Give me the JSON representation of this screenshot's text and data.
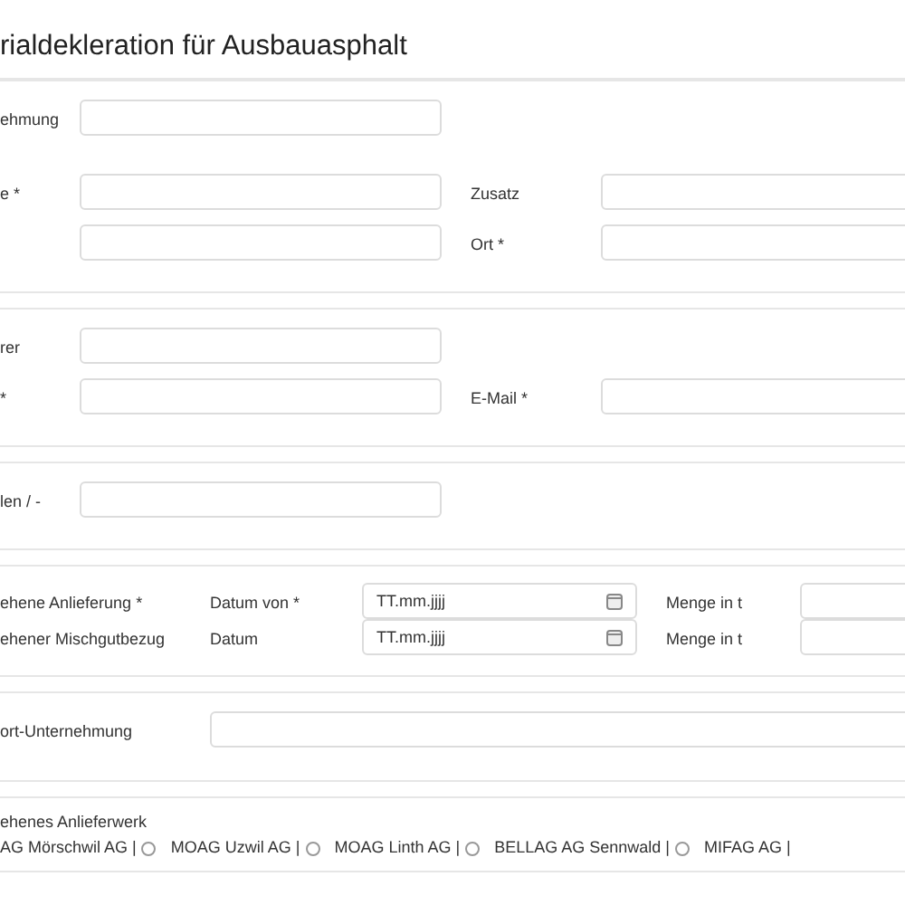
{
  "title": "rialdekleration für Ausbauasphalt",
  "sections": [
    {
      "kind": "form",
      "rows": [
        {
          "fields": [
            {
              "kind": "text",
              "label": "ehmung"
            }
          ]
        },
        {
          "fields": [
            {
              "kind": "text",
              "label": "e *"
            },
            {
              "kind": "text",
              "label": "Zusatz"
            }
          ]
        },
        {
          "fields": [
            {
              "kind": "text"
            },
            {
              "kind": "text",
              "label": "Ort *"
            }
          ]
        }
      ]
    },
    {
      "kind": "form",
      "rows": [
        {
          "fields": [
            {
              "kind": "text",
              "label": "rer"
            }
          ]
        },
        {
          "fields": [
            {
              "kind": "text",
              "label": "*"
            },
            {
              "kind": "text",
              "label": "E-Mail *"
            }
          ]
        }
      ]
    },
    {
      "kind": "form",
      "rows": [
        {
          "fields": [
            {
              "kind": "text",
              "label": "len / -"
            }
          ]
        }
      ]
    },
    {
      "kind": "schedule",
      "rows": [
        {
          "label": "ehene Anlieferung *",
          "fields": [
            {
              "kind": "date",
              "label": "Datum von *",
              "placeholder": "TT.mm.jjjj"
            },
            {
              "kind": "text",
              "label": "Menge in t"
            }
          ]
        },
        {
          "label": "ehener Mischgutbezug",
          "fields": [
            {
              "kind": "date",
              "label": "Datum",
              "placeholder": "TT.mm.jjjj"
            },
            {
              "kind": "text",
              "label": "Menge in t"
            }
          ]
        }
      ]
    },
    {
      "kind": "wide",
      "rows": [
        {
          "label": "ort-Unternehmung",
          "fields": [
            {
              "kind": "text"
            }
          ]
        }
      ]
    },
    {
      "kind": "choice",
      "label": "ehenes Anlieferwerk",
      "leading_text": "AG Mörschwil AG |",
      "options": [
        {
          "label": "MOAG Uzwil AG |",
          "selected": false
        },
        {
          "label": "MOAG Linth AG |",
          "selected": false
        },
        {
          "label": "BELLAG AG Sennwald |",
          "selected": false
        },
        {
          "label": "MIFAG AG |",
          "selected": false
        }
      ]
    }
  ]
}
